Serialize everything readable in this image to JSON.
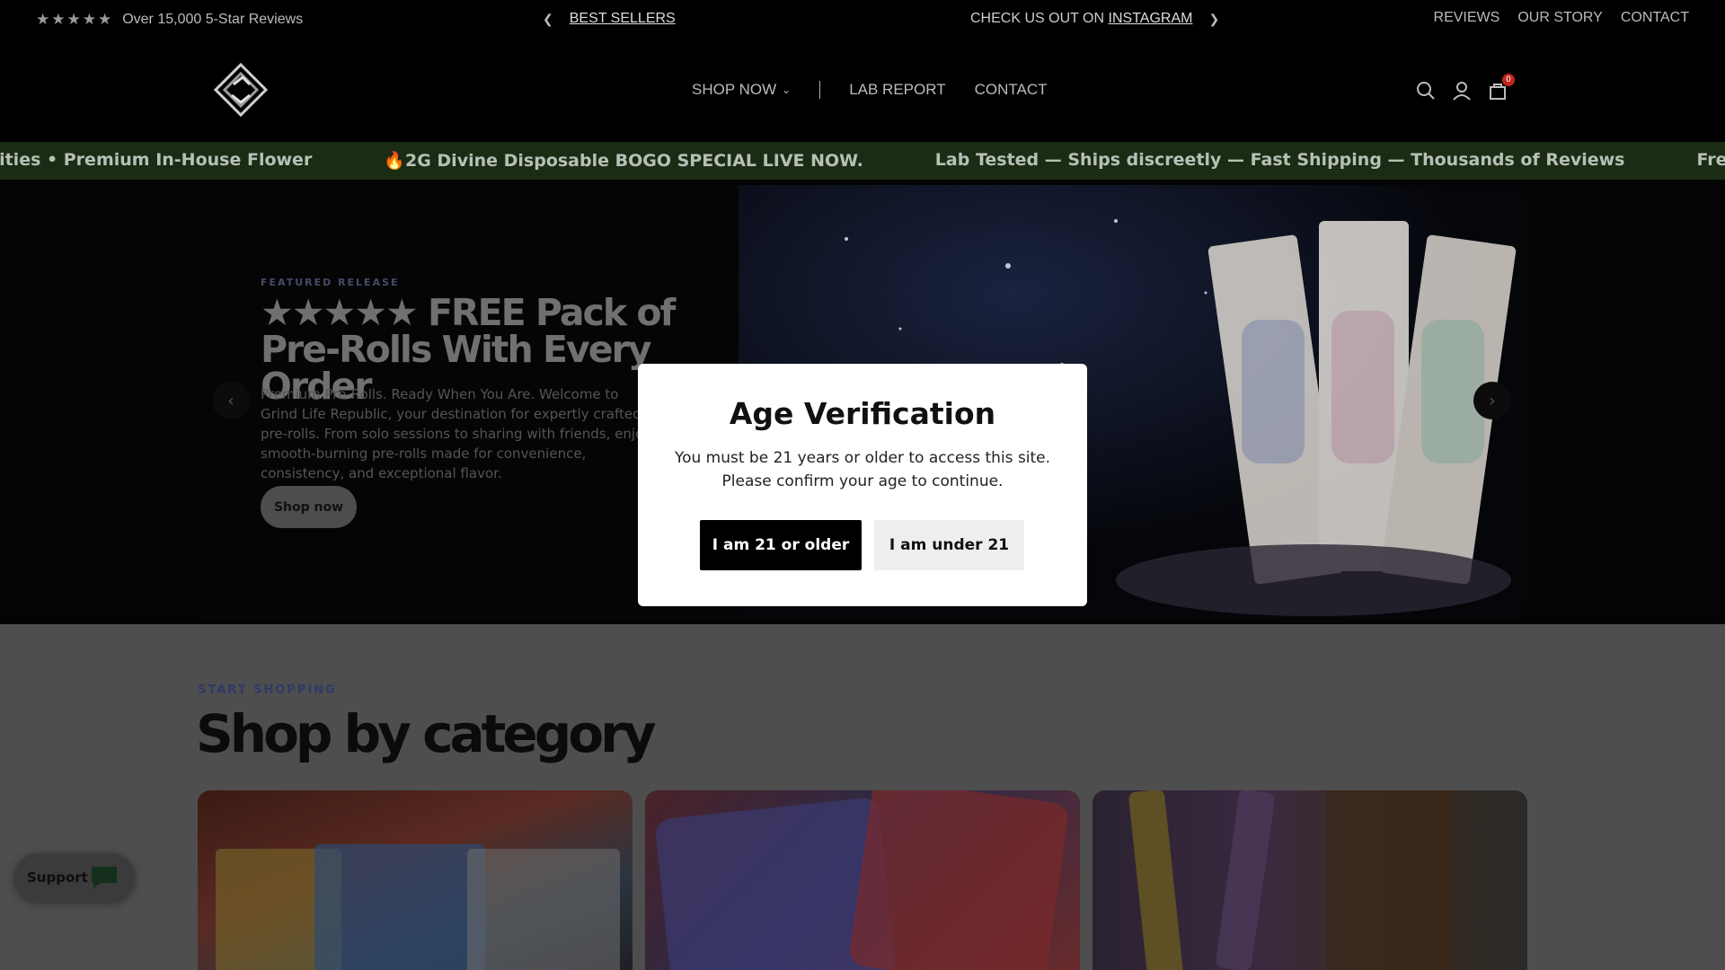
{
  "announcement": {
    "rating_text": "Over 15,000 5-Star Reviews",
    "stars": "★★★★★",
    "best_sellers": "BEST SELLERS",
    "instagram_prefix": "CHECK US OUT ON",
    "instagram_link": "INSTAGRAM",
    "links": [
      "REVIEWS",
      "OUR STORY",
      "CONTACT"
    ]
  },
  "header": {
    "nav": {
      "shop_now": "SHOP NOW",
      "lab_report": "LAB REPORT",
      "contact": "CONTACT"
    },
    "cart_count": "0"
  },
  "marquee": {
    "items": [
      "tities • Premium In-House Flower",
      "🔥2G Divine Disposable BOGO SPECIAL LIVE NOW.",
      "Lab Tested — Ships discreetly — Fast Shipping — Thousands of Reviews",
      "Free Pack Of Pre-Rolls With Every"
    ]
  },
  "hero": {
    "eyebrow": "FEATURED RELEASE",
    "title": "★★★★★ FREE Pack of Pre-Rolls With Every Order",
    "text": "Premium Pre-Rolls. Ready When You Are. Welcome to Grind Life Republic, your destination for expertly crafted pre-rolls. From solo sessions to sharing with friends, enjoy smooth-burning pre-rolls made for convenience, consistency, and exceptional flavor.",
    "button": "Shop now",
    "prev": "‹",
    "next": "›"
  },
  "category": {
    "eyebrow": "START SHOPPING",
    "title": "Shop by category"
  },
  "support": {
    "label": "Support"
  },
  "modal": {
    "title": "Age Verification",
    "line1": "You must be 21 years or older to access this site.",
    "line2": "Please confirm your age to continue.",
    "confirm": "I am 21 or older",
    "deny": "I am under 21"
  },
  "colors": {
    "marquee_bg": "#1a2d14",
    "cart_badge": "#c0261d",
    "overlay_bg": "#4e4e4e"
  }
}
